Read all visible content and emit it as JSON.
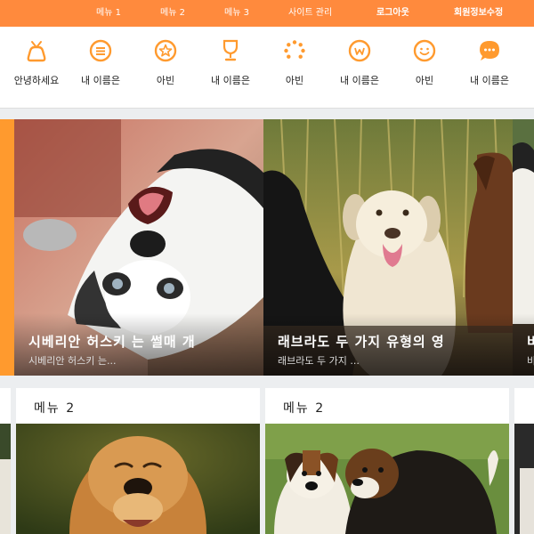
{
  "topbar": {
    "menu1": "메뉴 1",
    "menu2": "메뉴 2",
    "menu3": "메뉴 3",
    "site_admin": "사이트 관리",
    "logout": "로그아웃",
    "edit_profile": "회원정보수정"
  },
  "nav": {
    "items": [
      {
        "label": "안녕하세요",
        "icon": "tv-icon"
      },
      {
        "label": "내 이름은",
        "icon": "list-icon"
      },
      {
        "label": "아빈",
        "icon": "star-icon"
      },
      {
        "label": "내 이름은",
        "icon": "trophy-icon"
      },
      {
        "label": "아빈",
        "icon": "loading-icon"
      },
      {
        "label": "내 이름은",
        "icon": "w-icon"
      },
      {
        "label": "아빈",
        "icon": "smile-icon"
      },
      {
        "label": "내 이름은",
        "icon": "chat-icon"
      }
    ]
  },
  "slides": [
    {
      "title": "시베리안 허스키 는 썰매 개",
      "desc": "시베리안 허스키 는..."
    },
    {
      "title": "래브라도 두 가지 유형의 영",
      "desc": "래브라도 두 가지 ..."
    },
    {
      "title": "비",
      "desc": "비"
    }
  ],
  "cards": [
    {
      "title": "메뉴 2"
    },
    {
      "title": "메뉴 2"
    }
  ],
  "colors": {
    "accent": "#ff8a3d"
  }
}
